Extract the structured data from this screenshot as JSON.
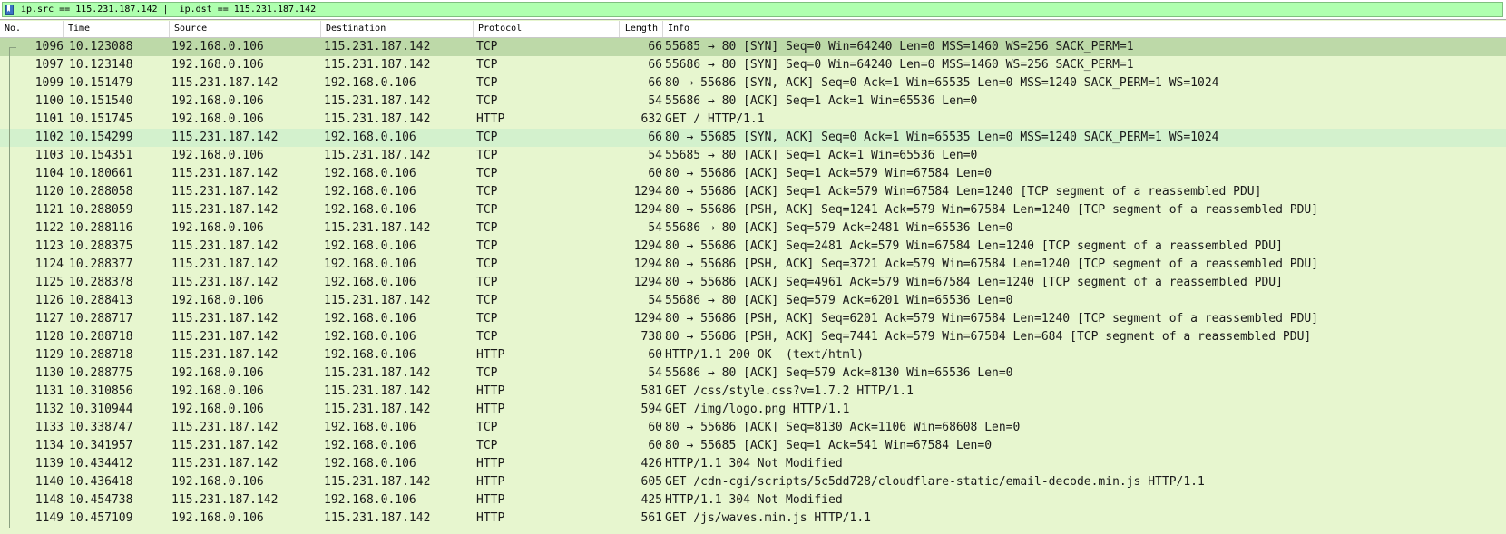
{
  "filter": {
    "text": "ip.src == 115.231.187.142 || ip.dst == 115.231.187.142"
  },
  "columns": {
    "no": "No.",
    "time": "Time",
    "source": "Source",
    "destination": "Destination",
    "protocol": "Protocol",
    "length": "Length",
    "info": "Info"
  },
  "colors": {
    "filter_bg": "#afffaf",
    "row_bg": "#e7f6cf",
    "selected_bg": "#bdd9a8",
    "highlight_bg": "#d3f1cd"
  },
  "packets": [
    {
      "no": "1096",
      "time": "10.123088",
      "src": "192.168.0.106",
      "dst": "115.231.187.142",
      "proto": "TCP",
      "len": "66",
      "info": "55685 → 80 [SYN] Seq=0 Win=64240 Len=0 MSS=1460 WS=256 SACK_PERM=1",
      "state": "selected"
    },
    {
      "no": "1097",
      "time": "10.123148",
      "src": "192.168.0.106",
      "dst": "115.231.187.142",
      "proto": "TCP",
      "len": "66",
      "info": "55686 → 80 [SYN] Seq=0 Win=64240 Len=0 MSS=1460 WS=256 SACK_PERM=1",
      "state": ""
    },
    {
      "no": "1099",
      "time": "10.151479",
      "src": "115.231.187.142",
      "dst": "192.168.0.106",
      "proto": "TCP",
      "len": "66",
      "info": "80 → 55686 [SYN, ACK] Seq=0 Ack=1 Win=65535 Len=0 MSS=1240 SACK_PERM=1 WS=1024",
      "state": ""
    },
    {
      "no": "1100",
      "time": "10.151540",
      "src": "192.168.0.106",
      "dst": "115.231.187.142",
      "proto": "TCP",
      "len": "54",
      "info": "55686 → 80 [ACK] Seq=1 Ack=1 Win=65536 Len=0",
      "state": ""
    },
    {
      "no": "1101",
      "time": "10.151745",
      "src": "192.168.0.106",
      "dst": "115.231.187.142",
      "proto": "HTTP",
      "len": "632",
      "info": "GET / HTTP/1.1",
      "state": ""
    },
    {
      "no": "1102",
      "time": "10.154299",
      "src": "115.231.187.142",
      "dst": "192.168.0.106",
      "proto": "TCP",
      "len": "66",
      "info": "80 → 55685 [SYN, ACK] Seq=0 Ack=1 Win=65535 Len=0 MSS=1240 SACK_PERM=1 WS=1024",
      "state": "hl"
    },
    {
      "no": "1103",
      "time": "10.154351",
      "src": "192.168.0.106",
      "dst": "115.231.187.142",
      "proto": "TCP",
      "len": "54",
      "info": "55685 → 80 [ACK] Seq=1 Ack=1 Win=65536 Len=0",
      "state": ""
    },
    {
      "no": "1104",
      "time": "10.180661",
      "src": "115.231.187.142",
      "dst": "192.168.0.106",
      "proto": "TCP",
      "len": "60",
      "info": "80 → 55686 [ACK] Seq=1 Ack=579 Win=67584 Len=0",
      "state": ""
    },
    {
      "no": "1120",
      "time": "10.288058",
      "src": "115.231.187.142",
      "dst": "192.168.0.106",
      "proto": "TCP",
      "len": "1294",
      "info": "80 → 55686 [ACK] Seq=1 Ack=579 Win=67584 Len=1240 [TCP segment of a reassembled PDU]",
      "state": ""
    },
    {
      "no": "1121",
      "time": "10.288059",
      "src": "115.231.187.142",
      "dst": "192.168.0.106",
      "proto": "TCP",
      "len": "1294",
      "info": "80 → 55686 [PSH, ACK] Seq=1241 Ack=579 Win=67584 Len=1240 [TCP segment of a reassembled PDU]",
      "state": ""
    },
    {
      "no": "1122",
      "time": "10.288116",
      "src": "192.168.0.106",
      "dst": "115.231.187.142",
      "proto": "TCP",
      "len": "54",
      "info": "55686 → 80 [ACK] Seq=579 Ack=2481 Win=65536 Len=0",
      "state": ""
    },
    {
      "no": "1123",
      "time": "10.288375",
      "src": "115.231.187.142",
      "dst": "192.168.0.106",
      "proto": "TCP",
      "len": "1294",
      "info": "80 → 55686 [ACK] Seq=2481 Ack=579 Win=67584 Len=1240 [TCP segment of a reassembled PDU]",
      "state": ""
    },
    {
      "no": "1124",
      "time": "10.288377",
      "src": "115.231.187.142",
      "dst": "192.168.0.106",
      "proto": "TCP",
      "len": "1294",
      "info": "80 → 55686 [PSH, ACK] Seq=3721 Ack=579 Win=67584 Len=1240 [TCP segment of a reassembled PDU]",
      "state": ""
    },
    {
      "no": "1125",
      "time": "10.288378",
      "src": "115.231.187.142",
      "dst": "192.168.0.106",
      "proto": "TCP",
      "len": "1294",
      "info": "80 → 55686 [ACK] Seq=4961 Ack=579 Win=67584 Len=1240 [TCP segment of a reassembled PDU]",
      "state": ""
    },
    {
      "no": "1126",
      "time": "10.288413",
      "src": "192.168.0.106",
      "dst": "115.231.187.142",
      "proto": "TCP",
      "len": "54",
      "info": "55686 → 80 [ACK] Seq=579 Ack=6201 Win=65536 Len=0",
      "state": ""
    },
    {
      "no": "1127",
      "time": "10.288717",
      "src": "115.231.187.142",
      "dst": "192.168.0.106",
      "proto": "TCP",
      "len": "1294",
      "info": "80 → 55686 [PSH, ACK] Seq=6201 Ack=579 Win=67584 Len=1240 [TCP segment of a reassembled PDU]",
      "state": ""
    },
    {
      "no": "1128",
      "time": "10.288718",
      "src": "115.231.187.142",
      "dst": "192.168.0.106",
      "proto": "TCP",
      "len": "738",
      "info": "80 → 55686 [PSH, ACK] Seq=7441 Ack=579 Win=67584 Len=684 [TCP segment of a reassembled PDU]",
      "state": ""
    },
    {
      "no": "1129",
      "time": "10.288718",
      "src": "115.231.187.142",
      "dst": "192.168.0.106",
      "proto": "HTTP",
      "len": "60",
      "info": "HTTP/1.1 200 OK  (text/html)",
      "state": ""
    },
    {
      "no": "1130",
      "time": "10.288775",
      "src": "192.168.0.106",
      "dst": "115.231.187.142",
      "proto": "TCP",
      "len": "54",
      "info": "55686 → 80 [ACK] Seq=579 Ack=8130 Win=65536 Len=0",
      "state": ""
    },
    {
      "no": "1131",
      "time": "10.310856",
      "src": "192.168.0.106",
      "dst": "115.231.187.142",
      "proto": "HTTP",
      "len": "581",
      "info": "GET /css/style.css?v=1.7.2 HTTP/1.1",
      "state": ""
    },
    {
      "no": "1132",
      "time": "10.310944",
      "src": "192.168.0.106",
      "dst": "115.231.187.142",
      "proto": "HTTP",
      "len": "594",
      "info": "GET /img/logo.png HTTP/1.1",
      "state": ""
    },
    {
      "no": "1133",
      "time": "10.338747",
      "src": "115.231.187.142",
      "dst": "192.168.0.106",
      "proto": "TCP",
      "len": "60",
      "info": "80 → 55686 [ACK] Seq=8130 Ack=1106 Win=68608 Len=0",
      "state": ""
    },
    {
      "no": "1134",
      "time": "10.341957",
      "src": "115.231.187.142",
      "dst": "192.168.0.106",
      "proto": "TCP",
      "len": "60",
      "info": "80 → 55685 [ACK] Seq=1 Ack=541 Win=67584 Len=0",
      "state": ""
    },
    {
      "no": "1139",
      "time": "10.434412",
      "src": "115.231.187.142",
      "dst": "192.168.0.106",
      "proto": "HTTP",
      "len": "426",
      "info": "HTTP/1.1 304 Not Modified",
      "state": ""
    },
    {
      "no": "1140",
      "time": "10.436418",
      "src": "192.168.0.106",
      "dst": "115.231.187.142",
      "proto": "HTTP",
      "len": "605",
      "info": "GET /cdn-cgi/scripts/5c5dd728/cloudflare-static/email-decode.min.js HTTP/1.1",
      "state": ""
    },
    {
      "no": "1148",
      "time": "10.454738",
      "src": "115.231.187.142",
      "dst": "192.168.0.106",
      "proto": "HTTP",
      "len": "425",
      "info": "HTTP/1.1 304 Not Modified",
      "state": ""
    },
    {
      "no": "1149",
      "time": "10.457109",
      "src": "192.168.0.106",
      "dst": "115.231.187.142",
      "proto": "HTTP",
      "len": "561",
      "info": "GET /js/waves.min.js HTTP/1.1",
      "state": ""
    }
  ]
}
